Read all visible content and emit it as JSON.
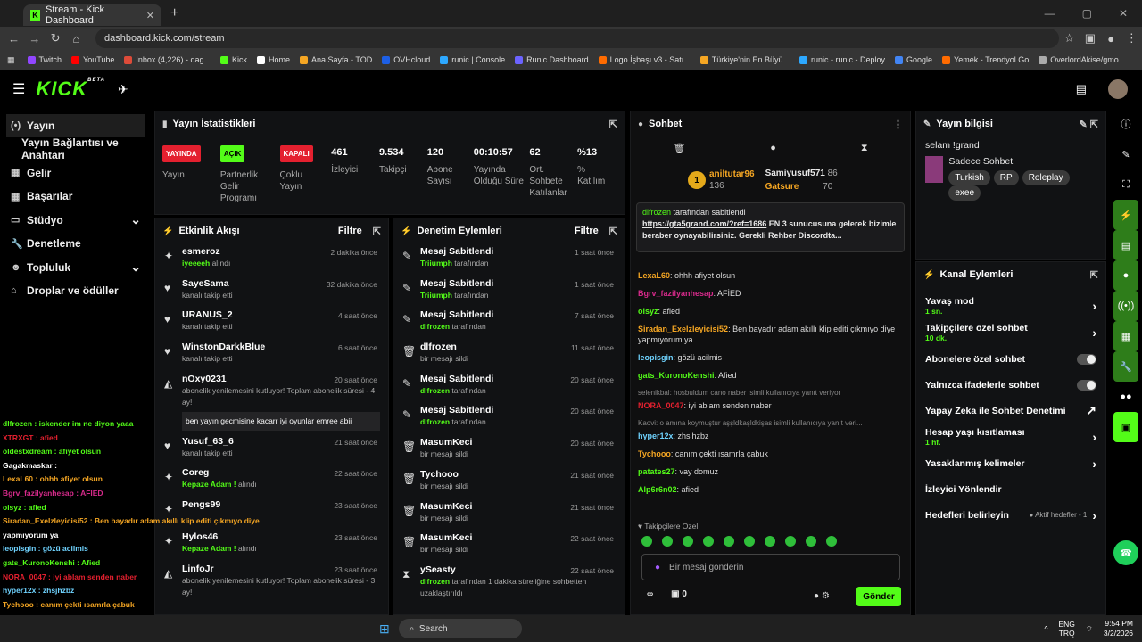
{
  "browser": {
    "tab_title": "Stream - Kick Dashboard",
    "url": "dashboard.kick.com/stream",
    "bookmarks": [
      "Twitch",
      "YouTube",
      "Inbox (4,226) - dag...",
      "Kick",
      "Home",
      "Ana Sayfa - TOD",
      "OVHcloud",
      "runic | Console",
      "Runic Dashboard",
      "Logo İşbaşı v3 - Satı...",
      "Türkiye'nin En Büyü...",
      "runic - runic - Deploy",
      "Google",
      "Yemek - Trendyol Go",
      "OverlordAkise/gmo..."
    ]
  },
  "topbar": {
    "logo": "KICK",
    "beta": "BETA"
  },
  "sidebar": {
    "items": [
      {
        "label": "Yayın",
        "icon": "(•)"
      },
      {
        "label": "Yayın Bağlantısı ve Anahtarı",
        "icon": ""
      },
      {
        "label": "Gelir",
        "icon": "▦"
      },
      {
        "label": "Başarılar",
        "icon": "▦"
      },
      {
        "label": "Stüdyo",
        "icon": "▭",
        "chev": "⌄"
      },
      {
        "label": "Denetleme",
        "icon": "🔧"
      },
      {
        "label": "Topluluk",
        "icon": "☻",
        "chev": "⌄"
      },
      {
        "label": "Droplar ve ödüller",
        "icon": "⌂"
      }
    ]
  },
  "stats": {
    "title": "Yayın İstatistikleri",
    "items": [
      {
        "badge": "YAYINDA",
        "badge_color": "#e4202f",
        "label": "Yayın"
      },
      {
        "badge": "AÇIK",
        "badge_color": "#53fc18",
        "label": "Partnerlik Gelir Programı"
      },
      {
        "badge": "KAPALI",
        "badge_color": "#e4202f",
        "label": "Çoklu Yayın"
      },
      {
        "num": "461",
        "label": "İzleyici"
      },
      {
        "num": "9.534",
        "label": "Takipçi"
      },
      {
        "num": "120",
        "label": "Abone Sayısı"
      },
      {
        "num": "00:10:57",
        "label": "Yayında Olduğu Süre"
      },
      {
        "num": "62",
        "label": "Ort. Sohbete Katılanlar"
      },
      {
        "num": "%13",
        "label": "% Katılım"
      }
    ]
  },
  "activity": {
    "title": "Etkinlik Akışı",
    "filter": "Filtre",
    "rows": [
      {
        "icon": "✦",
        "name": "esmeroz",
        "sub": "iyeeeeh",
        "sub2": " alındı",
        "time": "2 dakika önce"
      },
      {
        "icon": "♥",
        "name": "SayeSama",
        "sub": "",
        "sub2": "kanalı takip etti",
        "time": "32 dakika önce"
      },
      {
        "icon": "♥",
        "name": "URANUS_2",
        "sub": "",
        "sub2": "kanalı takip etti",
        "time": "4 saat önce"
      },
      {
        "icon": "♥",
        "name": "WinstonDarkkBlue",
        "sub": "",
        "sub2": "kanalı takip etti",
        "time": "6 saat önce"
      },
      {
        "icon": "◭",
        "name": "nOxy0231",
        "sub": "",
        "sub2": "abonelik yenilemesini kutluyor! Toplam abonelik süresi - 4 ay!",
        "time": "20 saat önce",
        "msg": "ben yayın gecmisine kacarr iyi oyunlar emree abii"
      },
      {
        "icon": "♥",
        "name": "Yusuf_63_6",
        "sub": "",
        "sub2": "kanalı takip etti",
        "time": "21 saat önce"
      },
      {
        "icon": "✦",
        "name": "Coreg",
        "sub": "Kepaze Adam !",
        "sub2": " alındı",
        "time": "22 saat önce"
      },
      {
        "icon": "✦",
        "name": "Pengs99",
        "sub": "",
        "sub2": "",
        "time": "23 saat önce"
      },
      {
        "icon": "✦",
        "name": "Hylos46",
        "sub": "Kepaze Adam !",
        "sub2": " alındı",
        "time": "23 saat önce"
      },
      {
        "icon": "◭",
        "name": "LinfoJr",
        "sub": "",
        "sub2": "abonelik yenilemesini kutluyor! Toplam abonelik süresi - 3 ay!",
        "time": "23 saat önce"
      }
    ]
  },
  "moderation": {
    "title": "Denetim Eylemleri",
    "filter": "Filtre",
    "rows": [
      {
        "icon": "✎",
        "name": "Mesaj Sabitlendi",
        "sub": "Triiumph",
        "sub2": " tarafından",
        "time": "1 saat önce"
      },
      {
        "icon": "✎",
        "name": "Mesaj Sabitlendi",
        "sub": "Triiumph",
        "sub2": " tarafından",
        "time": "1 saat önce"
      },
      {
        "icon": "✎",
        "name": "Mesaj Sabitlendi",
        "sub": "dlfrozen",
        "sub2": " tarafından",
        "time": "7 saat önce"
      },
      {
        "icon": "🗑",
        "name": "dlfrozen",
        "sub": "",
        "sub2": "bir mesajı sildi",
        "time": "11 saat önce"
      },
      {
        "icon": "✎",
        "name": "Mesaj Sabitlendi",
        "sub": "dlfrozen",
        "sub2": " tarafından",
        "time": "20 saat önce"
      },
      {
        "icon": "✎",
        "name": "Mesaj Sabitlendi",
        "sub": "dlfrozen",
        "sub2": " tarafından",
        "time": "20 saat önce"
      },
      {
        "icon": "🗑",
        "name": "MasumKeci",
        "sub": "",
        "sub2": "bir mesajı sildi",
        "time": "20 saat önce"
      },
      {
        "icon": "🗑",
        "name": "Tychooo",
        "sub": "",
        "sub2": "bir mesajı sildi",
        "time": "21 saat önce"
      },
      {
        "icon": "🗑",
        "name": "MasumKeci",
        "sub": "",
        "sub2": "bir mesajı sildi",
        "time": "21 saat önce"
      },
      {
        "icon": "🗑",
        "name": "MasumKeci",
        "sub": "",
        "sub2": "bir mesajı sildi",
        "time": "22 saat önce"
      },
      {
        "icon": "⧗",
        "name": "ySeasty",
        "sub": "dlfrozen",
        "sub2": " tarafından 1 dakika süreliğine sohbetten uzaklaştırıldı",
        "time": "22 saat önce"
      }
    ]
  },
  "chat": {
    "title": "Sohbet",
    "top1": "aniltutar96",
    "top1v": "136",
    "top2": "Samiyusuf571",
    "top2v": "86",
    "top3": "Gatsure",
    "top3v": "70",
    "pinned_by": "dlfrozen",
    "pinned_label": " tarafından sabitlendi",
    "pinned_link": "https://gta5grand.com/?ref=1686",
    "pinned_text": " EN 3 sunucusuna gelerek bizimle beraber oynayabilirsiniz. Gerekli Rehber Discordta...",
    "lines": [
      {
        "user": "LexaL60",
        "color": "#f5a623",
        "text": ": ohhh afiyet olsun"
      },
      {
        "user": "Bgrv_fazilyanhesap",
        "color": "#d62a8a",
        "text": ": AFİED"
      },
      {
        "user": "oisyz",
        "color": "#53fc18",
        "text": ": afied"
      },
      {
        "user": "Siradan_Exelzleyicisi52",
        "color": "#f5a623",
        "text": ": Ben bayadır adam akıllı klip editi çıkmıyo diye yapmıyorum ya"
      },
      {
        "user": "leopisgin",
        "color": "#6fd3ff",
        "text": ": gözü acilmis"
      },
      {
        "user": "gats_KuronoKenshi",
        "color": "#53fc18",
        "text": ": Afied"
      },
      {
        "user": "NORA_0047",
        "color": "#e4202f",
        "text": ": iyi ablam senden naber"
      },
      {
        "user": "hyper12x",
        "color": "#6fd3ff",
        "text": ": zhsjhzbz"
      },
      {
        "user": "Tychooo",
        "color": "#f5a623",
        "text": ": canım çekti ısamrla çabuk"
      },
      {
        "user": "patates27",
        "color": "#53fc18",
        "text": ": vay domuz"
      },
      {
        "user": "Alp6r6n02",
        "color": "#53fc18",
        "text": ": afied"
      }
    ],
    "reply1": "selenikbal: hosbuldum cano naber isimli kullanıcıya yanıt veriyor",
    "reply2": "Kaovi: o amına koymuştur aşşldkaşldkişas isimli kullanıcıya yanıt veri...",
    "followers_only": "Takipçilere Özel",
    "placeholder": "Bir mesaj gönderin",
    "count": "0",
    "send": "Gönder"
  },
  "info": {
    "title": "Yayın bilgisi",
    "stream_title": "selam !grand",
    "category": "Sadece Sohbet",
    "tags": [
      "Turkish",
      "RP",
      "Roleplay",
      "exee"
    ]
  },
  "channel": {
    "title": "Kanal Eylemleri",
    "rows": [
      {
        "label": "Yavaş mod",
        "sub": "1 sn.",
        "ctl": "›"
      },
      {
        "label": "Takipçilere özel sohbet",
        "sub": "10 dk.",
        "ctl": "›"
      },
      {
        "label": "Abonelere özel sohbet",
        "sub": "",
        "ctl": "toggle"
      },
      {
        "label": "Yalnızca ifadelerle sohbet",
        "sub": "",
        "ctl": "toggle"
      },
      {
        "label": "Yapay Zeka ile Sohbet Denetimi",
        "sub": "",
        "ctl": "↗"
      },
      {
        "label": "Hesap yaşı kısıtlaması",
        "sub": "1 hf.",
        "ctl": "›"
      },
      {
        "label": "Yasaklanmış kelimeler",
        "sub": "",
        "ctl": "›"
      },
      {
        "label": "İzleyici Yönlendir",
        "sub": "",
        "ctl": ""
      },
      {
        "label": "Hedefleri belirleyin",
        "sub": "",
        "ctl": "›",
        "extra": "● Aktif hedefler - 1"
      }
    ]
  },
  "overlay": {
    "lines": [
      "dlfrozen : iskender im ne diyon yaaa",
      "XTRXGT : afied",
      "oldestxdream : afiyet olsun",
      "Gagakmaskar :",
      "LexaL60 : ohhh afiyet olsun",
      "Bgrv_fazilyanhesap : AFİED",
      "oisyz : afied",
      "Siradan_Exelzleyicisi52 : Ben bayadır adam akıllı klip editi çıkmıyo diye",
      "yapmıyorum ya",
      "leopisgin : gözü acilmis",
      "gats_KuronoKenshi : Afied",
      "NORA_0047 : iyi ablam senden naber",
      "hyper12x : zhsjhzbz",
      "Tychooo : canım çekti ısamrla çabuk",
      "patates27 : vay domuz",
      "Alp6r6n02 : afied"
    ]
  },
  "taskbar": {
    "search": "Search",
    "lang1": "ENG",
    "lang2": "TRQ",
    "time": "9:54 PM",
    "date": "3/2/2026"
  }
}
